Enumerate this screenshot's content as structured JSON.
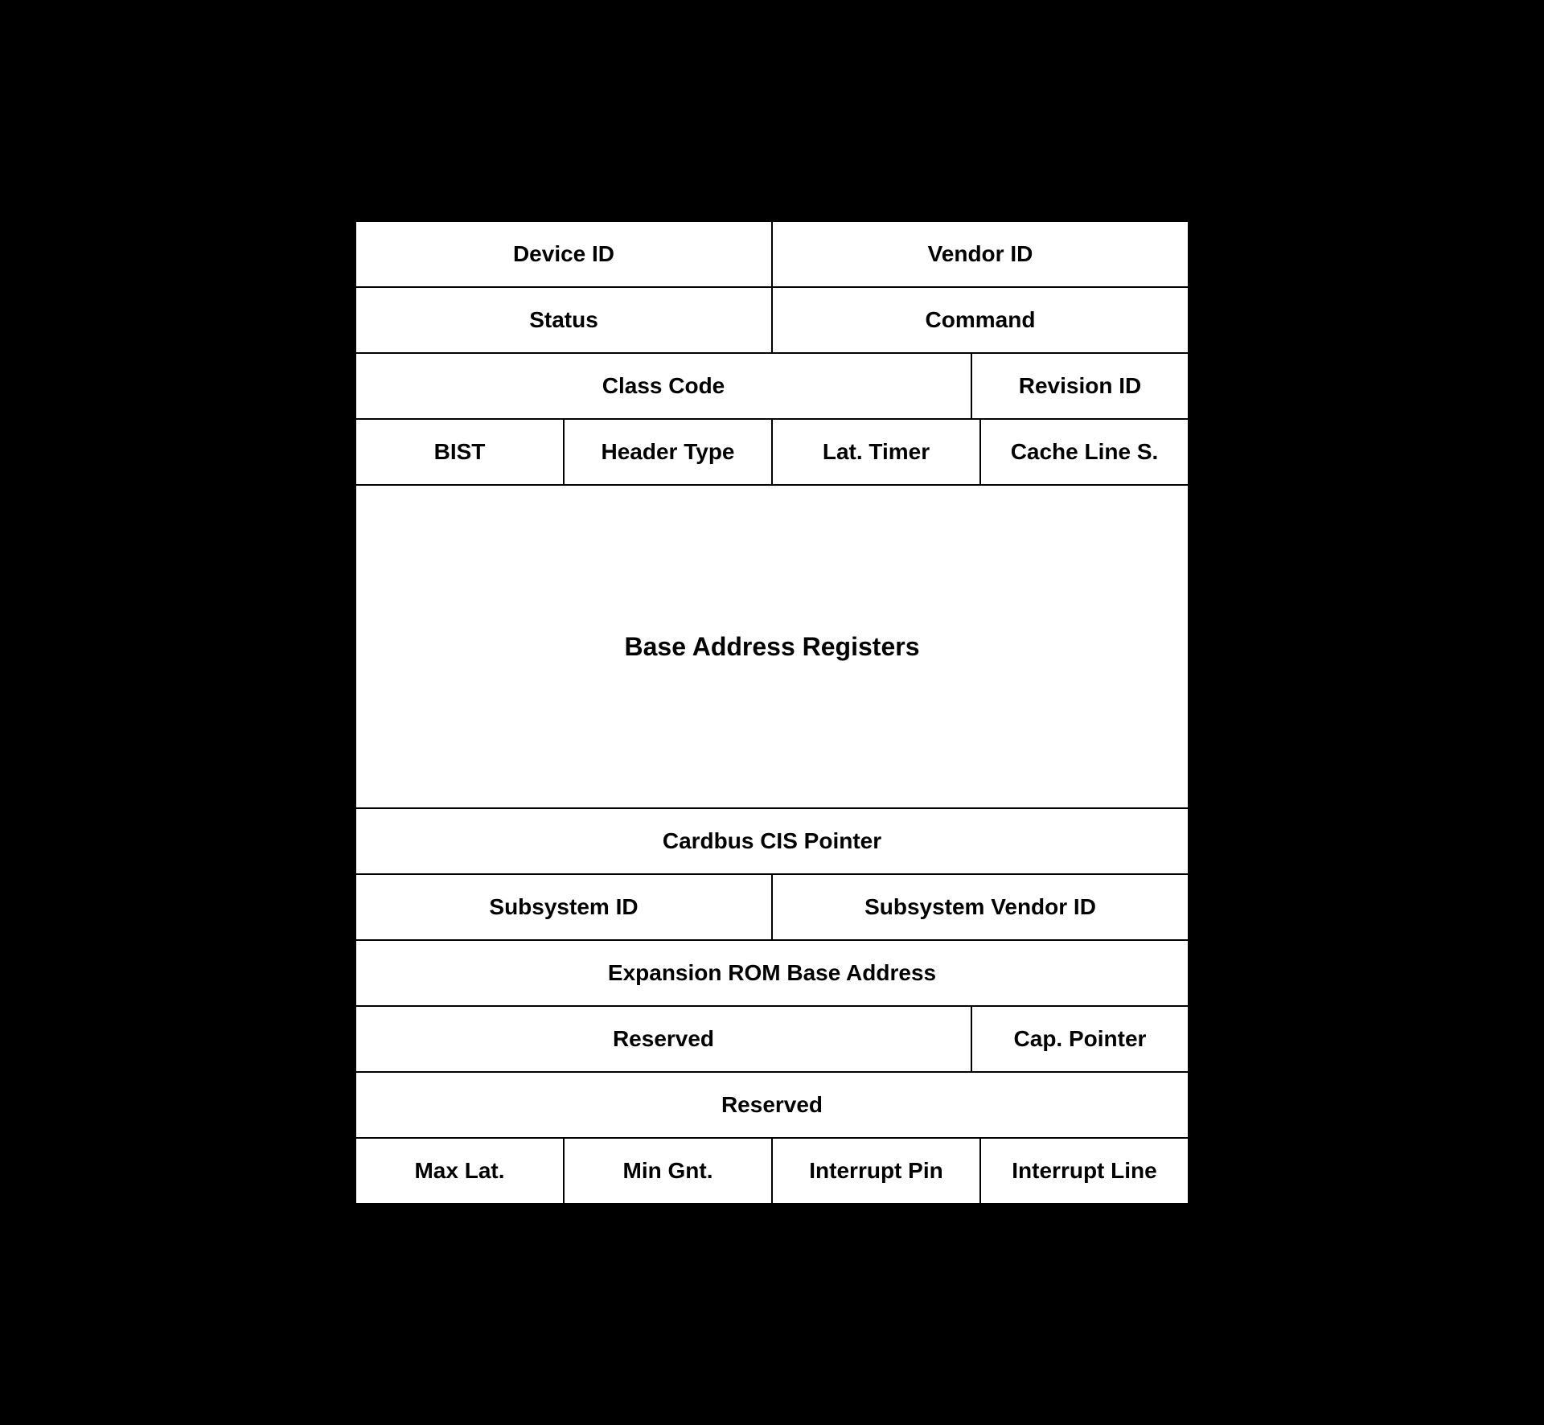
{
  "table": {
    "row1": {
      "device_id": "Device ID",
      "vendor_id": "Vendor ID"
    },
    "row2": {
      "status": "Status",
      "command": "Command"
    },
    "row3": {
      "class_code": "Class Code",
      "revision_id": "Revision ID"
    },
    "row4": {
      "bist": "BIST",
      "header_type": "Header Type",
      "lat_timer": "Lat. Timer",
      "cache_line": "Cache Line S."
    },
    "row5": {
      "bar": "Base Address Registers"
    },
    "row6": {
      "cardbus": "Cardbus CIS Pointer"
    },
    "row7": {
      "subsystem_id": "Subsystem ID",
      "subsystem_vendor_id": "Subsystem Vendor ID"
    },
    "row8": {
      "expansion_rom": "Expansion ROM Base Address"
    },
    "row9": {
      "reserved1": "Reserved",
      "cap_pointer": "Cap. Pointer"
    },
    "row10": {
      "reserved2": "Reserved"
    },
    "row11": {
      "max_lat": "Max Lat.",
      "min_gnt": "Min Gnt.",
      "interrupt_pin": "Interrupt Pin",
      "interrupt_line": "Interrupt Line"
    }
  }
}
